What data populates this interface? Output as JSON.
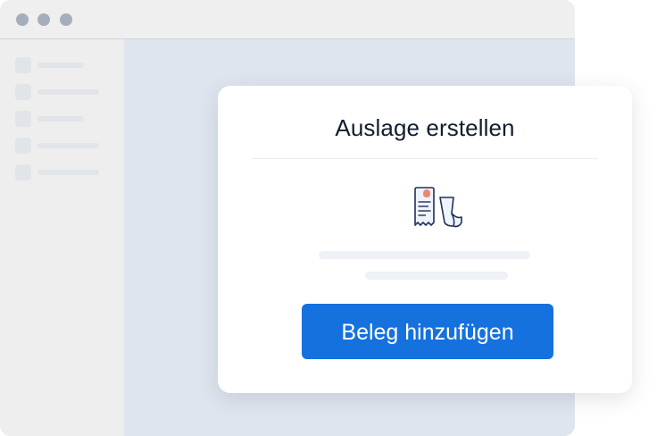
{
  "dialog": {
    "title": "Auslage erstellen",
    "button_label": "Beleg hinzufügen",
    "icon": "receipt-icon"
  },
  "colors": {
    "accent": "#1571de",
    "window_bg": "#dfe5ee",
    "titlebar_bg": "#efefef",
    "sidebar_bg": "#eeeeee"
  }
}
